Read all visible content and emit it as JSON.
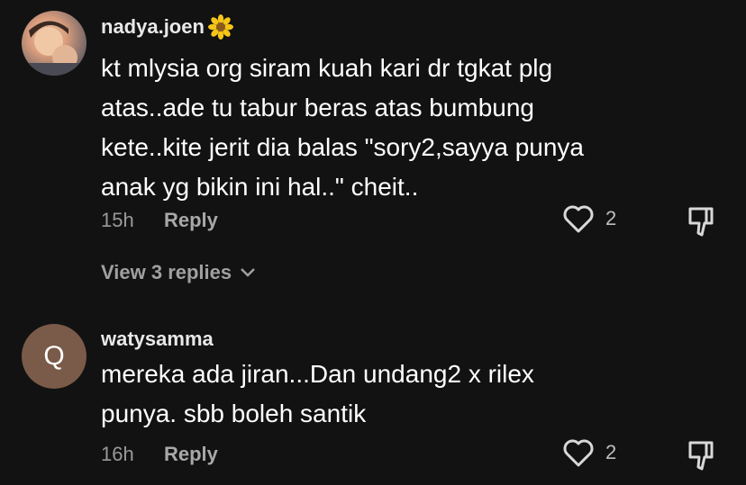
{
  "comments": [
    {
      "username": "nadya.joen",
      "avatar_icon": "user-photo",
      "badge_icon": "sunflower-icon",
      "text": "kt mlysia org siram kuah kari dr tgkat plg\natas..ade tu tabur beras atas bumbung\nkete..kite jerit dia balas \"sory2,sayya punya\nanak yg bikin ini hal..\" cheit..",
      "time": "15h",
      "reply_label": "Reply",
      "likes": "2",
      "view_replies_label": "View 3 replies"
    },
    {
      "username": "watysamma",
      "avatar_letter": "Q",
      "avatar_color": "#7a5a48",
      "text": "mereka ada jiran...Dan undang2 x rilex\npunya. sbb boleh santik",
      "time": "16h",
      "reply_label": "Reply",
      "likes": "2"
    }
  ]
}
